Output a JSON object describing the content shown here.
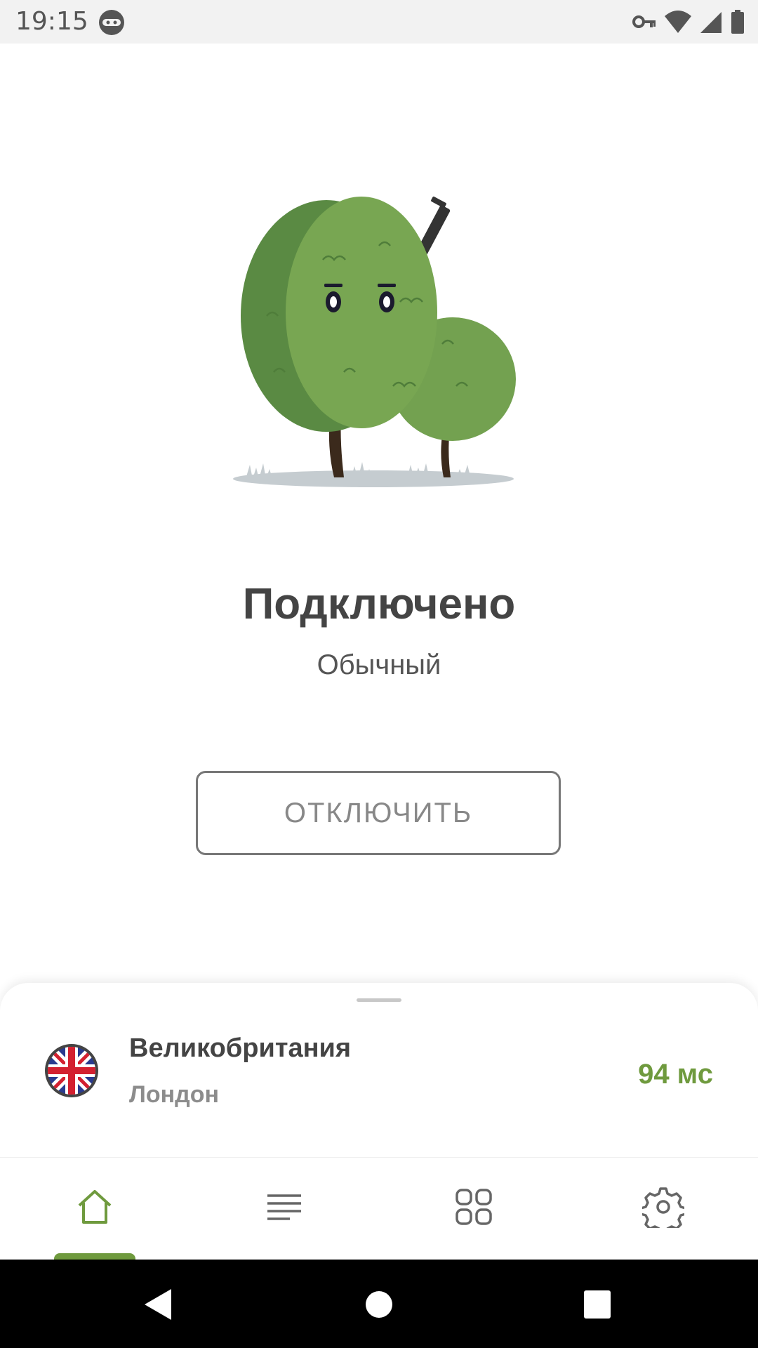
{
  "status_bar": {
    "time": "19:15",
    "icons": [
      "ninja-icon",
      "key-icon",
      "wifi-icon",
      "signal-icon",
      "battery-icon"
    ]
  },
  "hero": {
    "illustration": "bush-mascot-illustration"
  },
  "connection": {
    "status_title": "Подключено",
    "mode": "Обычный",
    "disconnect_label": "ОТКЛЮЧИТЬ"
  },
  "location": {
    "country": "Великобритания",
    "city": "Лондон",
    "ping": "94 мс",
    "flag": "uk-flag-icon",
    "ping_color": "#6f9a3e"
  },
  "bottom_nav": {
    "items": [
      {
        "icon": "home-icon",
        "active": true
      },
      {
        "icon": "list-icon",
        "active": false
      },
      {
        "icon": "apps-grid-icon",
        "active": false
      },
      {
        "icon": "gear-icon",
        "active": false
      }
    ],
    "accent": "#6f9a3e"
  },
  "system_nav": {
    "icons": [
      "back-icon",
      "home-circle-icon",
      "recents-icon"
    ]
  }
}
